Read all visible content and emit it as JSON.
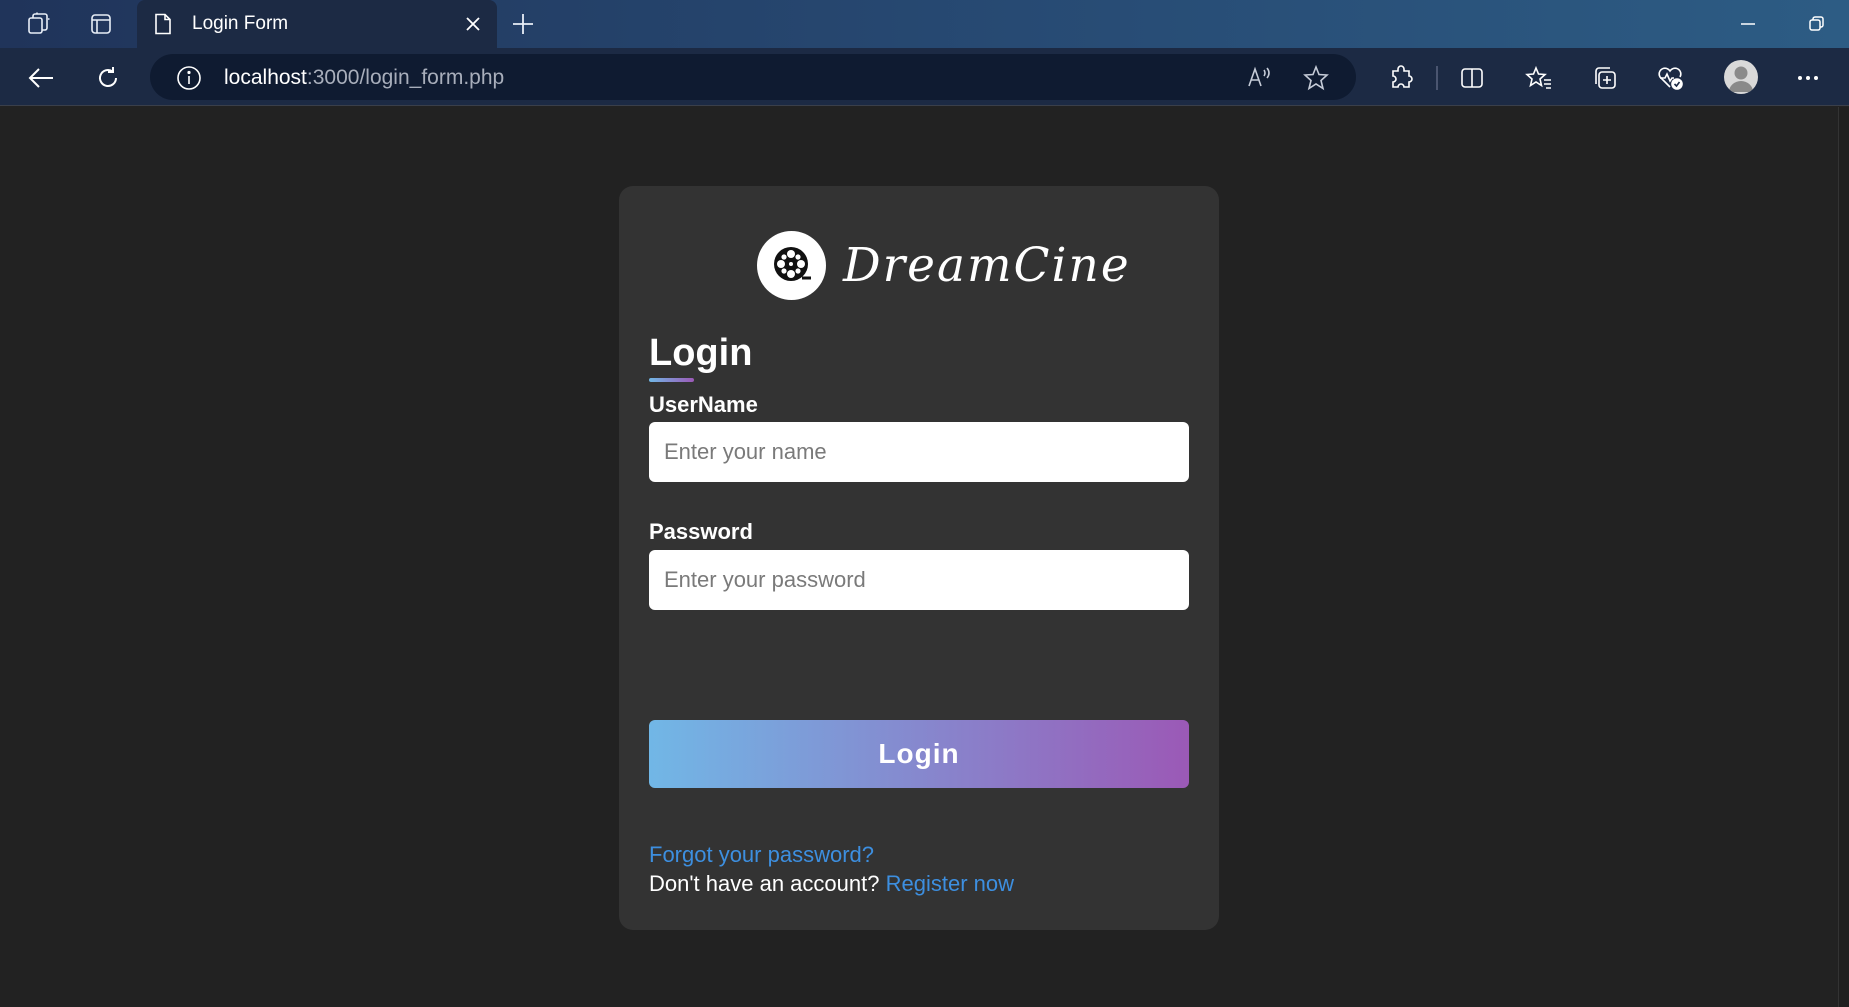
{
  "browser": {
    "tab_title": "Login Form",
    "url_host": "localhost",
    "url_rest": ":3000/login_form.php"
  },
  "brand": {
    "name": "DreamCine",
    "logo_icon": "film-reel-icon"
  },
  "form": {
    "heading": "Login",
    "username_label": "UserName",
    "username_placeholder": "Enter your name",
    "password_label": "Password",
    "password_placeholder": "Enter your password",
    "submit_label": "Login",
    "forgot_link": "Forgot your password?",
    "no_account_text": "Don't have an account?",
    "register_link": "Register now"
  },
  "colors": {
    "page_background": "#222222",
    "card_background": "#333333",
    "gradient_start": "#71b7e6",
    "gradient_end": "#9b59b6",
    "link": "#3d8fe0"
  }
}
